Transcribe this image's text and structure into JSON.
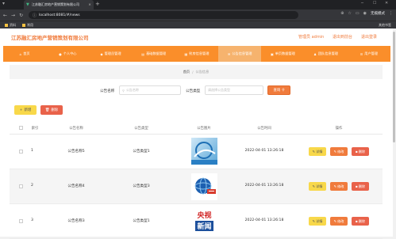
{
  "browser": {
    "tab_title": "江苏融汇房地产营销策划有限公司",
    "url": "localhost:8081/#/news",
    "profile_label": "无痕模式",
    "bookmarks": [
      "资料",
      "常用"
    ],
    "bookmarks_right": "其他书签"
  },
  "site": {
    "title": "江苏融汇房地产营销策划有限公司",
    "admin_label": "管理员 admin",
    "back_label": "退出到前台",
    "logout_label": "退出登录"
  },
  "nav": {
    "items": [
      {
        "label": "首页",
        "icon": "home-icon",
        "glyph": "⌂",
        "active": false
      },
      {
        "label": "个人中心",
        "icon": "user-icon",
        "glyph": "●",
        "active": false
      },
      {
        "label": "管理员管理",
        "icon": "admin-icon",
        "glyph": "◆",
        "active": false
      },
      {
        "label": "基础数据管理",
        "icon": "data-icon",
        "glyph": "▤",
        "active": false
      },
      {
        "label": "射房信息管理",
        "icon": "building-icon",
        "glyph": "▦",
        "active": false
      },
      {
        "label": "公告信息管理",
        "icon": "notice-icon",
        "glyph": "✉",
        "active": true
      },
      {
        "label": "单页数据管理",
        "icon": "page-icon",
        "glyph": "▣",
        "active": false
      },
      {
        "label": "团队信息管理",
        "icon": "team-icon",
        "glyph": "♟",
        "active": false
      },
      {
        "label": "用户管理",
        "icon": "users-icon",
        "glyph": "☰",
        "active": false
      }
    ]
  },
  "breadcrumb": {
    "home": "首页",
    "separator": "/",
    "current": "公告信息"
  },
  "search": {
    "name_label": "公告名称",
    "name_placeholder": "公告名称",
    "type_label": "公告类型",
    "type_placeholder": "请选择公告类型",
    "button_label": "查询"
  },
  "actions": {
    "add_label": "新增",
    "delete_label": "删除"
  },
  "table": {
    "headers": {
      "index": "索引",
      "name": "公告名称",
      "type": "公告类型",
      "image": "公告图片",
      "time": "公告时间",
      "ops": "操作"
    },
    "row_buttons": {
      "detail": "详情",
      "edit": "修改",
      "delete": "删除"
    },
    "rows": [
      {
        "index": "1",
        "name": "公告名称5",
        "type": "公告类型1",
        "time": "2022-04-01 13:26:18",
        "image": "blue-abstract-thumbnail"
      },
      {
        "index": "2",
        "name": "公告名称4",
        "type": "公告类型3",
        "time": "2022-04-01 13:26:18",
        "image": "news-globe-thumbnail"
      },
      {
        "index": "3",
        "name": "公告名称3",
        "type": "公告类型1",
        "time": "2022-04-01 13:26:18",
        "image": "cctv-news-logo-thumbnail",
        "logo_text": [
          "央视",
          "新闻"
        ]
      }
    ]
  },
  "colors": {
    "accent": "#f07b3c",
    "nav_bg": "#fa8e2a",
    "nav_active": "#f6b36e",
    "yellow_btn": "#f8d84a",
    "red_btn": "#e9624a"
  }
}
